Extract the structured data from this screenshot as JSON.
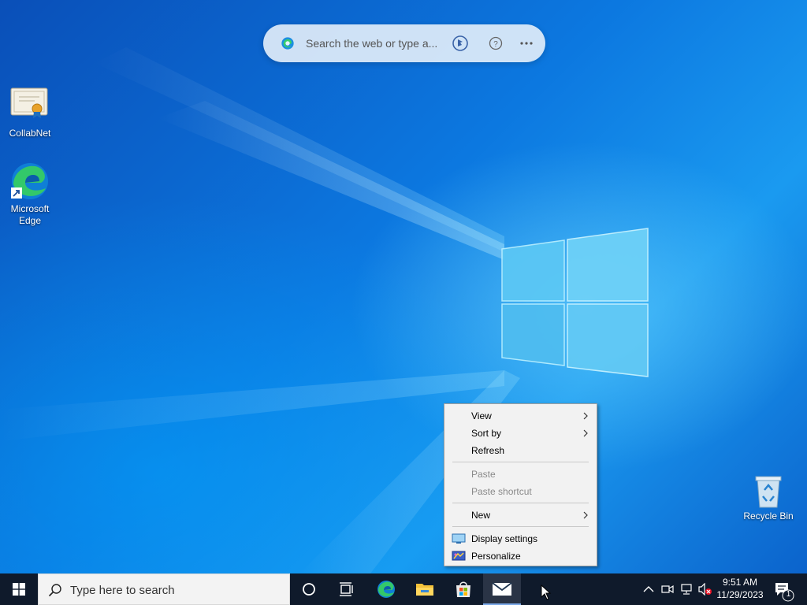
{
  "edge_search": {
    "placeholder": "Search the web or type a..."
  },
  "desktop_icons": [
    {
      "label": "CollabNet",
      "icon": "certificate-icon"
    },
    {
      "label": "Microsoft\nEdge",
      "icon": "edge-icon"
    },
    {
      "label": "Recycle Bin",
      "icon": "recycle-bin-icon"
    }
  ],
  "context_menu": {
    "items": [
      {
        "label": "View",
        "submenu": true,
        "enabled": true
      },
      {
        "label": "Sort by",
        "submenu": true,
        "enabled": true
      },
      {
        "label": "Refresh",
        "submenu": false,
        "enabled": true
      },
      {
        "label": "Paste",
        "submenu": false,
        "enabled": false
      },
      {
        "label": "Paste shortcut",
        "submenu": false,
        "enabled": false
      },
      {
        "label": "New",
        "submenu": true,
        "enabled": true
      },
      {
        "label": "Display settings",
        "submenu": false,
        "enabled": true,
        "icon": "display-icon"
      },
      {
        "label": "Personalize",
        "submenu": false,
        "enabled": true,
        "icon": "personalize-icon"
      }
    ]
  },
  "taskbar": {
    "search_placeholder": "Type here to search",
    "pinned": [
      "cortana-icon",
      "task-view-icon",
      "edge-icon",
      "file-explorer-icon",
      "store-icon",
      "mail-icon"
    ],
    "clock_time": "9:51 AM",
    "clock_date": "11/29/2023",
    "notification_count": "1"
  },
  "colors": {
    "taskbar": "#0f1a2b",
    "desktop_accent": "#0c78e0",
    "menu_bg": "#f2f2f2"
  }
}
